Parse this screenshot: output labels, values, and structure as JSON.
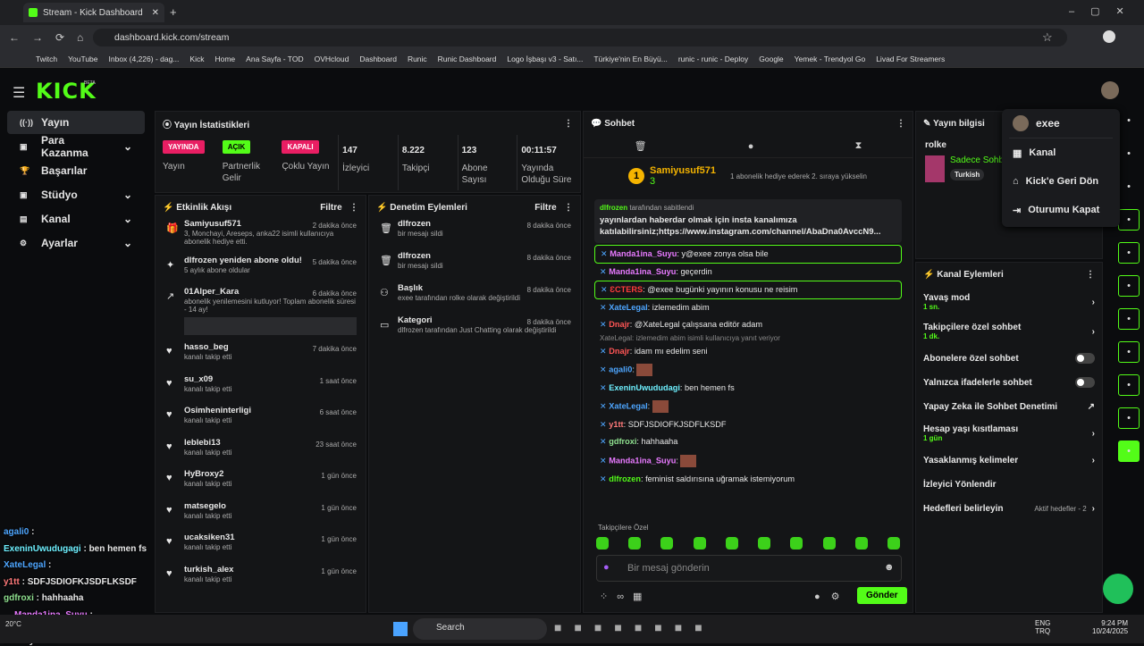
{
  "browser": {
    "tab_title": "Stream - Kick Dashboard",
    "url": "dashboard.kick.com/stream",
    "bookmarks": [
      "Twitch",
      "YouTube",
      "Inbox (4,226) - dag...",
      "Kick",
      "Home",
      "Ana Sayfa - TOD",
      "OVHcloud",
      "Dashboard",
      "Runic",
      "Runic Dashboard",
      "Logo İşbaşı v3 - Satı...",
      "Türkiye'nin En Büyü...",
      "runic - runic - Deploy",
      "Google",
      "Yemek - Trendyol Go",
      "Livad For Streamers"
    ]
  },
  "logo": "KICK",
  "logo_beta": "BETA",
  "sidebar": {
    "items": [
      {
        "label": "Yayın",
        "icon": "radio-icon"
      },
      {
        "label": "Para Kazanma",
        "icon": "wallet-icon"
      },
      {
        "label": "Başarılar",
        "icon": "trophy-icon"
      },
      {
        "label": "Stüdyo",
        "icon": "studio-icon"
      },
      {
        "label": "Kanal",
        "icon": "channel-icon"
      },
      {
        "label": "Ayarlar",
        "icon": "gear-icon"
      }
    ]
  },
  "stats": {
    "title": "Yayın İstatistikleri",
    "items": [
      {
        "badge": "YAYINDA",
        "label": "Yayın",
        "badge_color": "#e91e63"
      },
      {
        "badge": "AÇIK",
        "label": "Partnerlik Gelir",
        "badge_color": "#53fc18"
      },
      {
        "badge": "KAPALI",
        "label": "Çoklu Yayın",
        "badge_color": "#e91e63"
      },
      {
        "value": "147",
        "label": "İzleyici"
      },
      {
        "value": "8.222",
        "label": "Takipçi"
      },
      {
        "value": "123",
        "label": "Abone Sayısı"
      },
      {
        "value": "00:11:57",
        "label": "Yayında Olduğu Süre"
      }
    ]
  },
  "activity": {
    "title": "Etkinlik Akışı",
    "filter": "Filtre",
    "events": [
      {
        "name": "Samiyusuf571",
        "time": "2 dakika önce",
        "sub": "3, Monchayi, Areseps, anka22 isimli kullanıcıya abonelik hediye etti."
      },
      {
        "name": "dlfrozen yeniden abone oldu!",
        "time": "5 dakika önce",
        "sub": "5 aylık abone oldular"
      },
      {
        "name": "01Alper_Kara",
        "time": "6 dakika önce",
        "sub": "abonelik yenilemesini kutluyor! Toplam abonelik süresi - 14 ay!"
      },
      {
        "name": "hasso_beg",
        "time": "7 dakika önce",
        "sub": "kanalı takip etti"
      },
      {
        "name": "su_x09",
        "time": "1 saat önce",
        "sub": "kanalı takip etti"
      },
      {
        "name": "Osimheninterligi",
        "time": "6 saat önce",
        "sub": "kanalı takip etti"
      },
      {
        "name": "leblebi13",
        "time": "23 saat önce",
        "sub": "kanalı takip etti"
      },
      {
        "name": "HyBroxy2",
        "time": "1 gün önce",
        "sub": "kanalı takip etti"
      },
      {
        "name": "matsegelo",
        "time": "1 gün önce",
        "sub": "kanalı takip etti"
      },
      {
        "name": "ucaksiken31",
        "time": "1 gün önce",
        "sub": "kanalı takip etti"
      },
      {
        "name": "turkish_alex",
        "time": "1 gün önce",
        "sub": "kanalı takip etti"
      }
    ]
  },
  "moderation": {
    "title": "Denetim Eylemleri",
    "filter": "Filtre",
    "items": [
      {
        "name": "dlfrozen",
        "time": "8 dakika önce",
        "sub": "bir mesajı sildi"
      },
      {
        "name": "dlfrozen",
        "time": "8 dakika önce",
        "sub": "bir mesajı sildi"
      },
      {
        "name": "Başlık",
        "time": "8 dakika önce",
        "sub": "exee tarafından rolke olarak değiştirildi"
      },
      {
        "name": "Kategori",
        "time": "8 dakika önce",
        "sub": "dlfrozen tarafından Just Chatting olarak değiştirildi"
      }
    ]
  },
  "chat": {
    "title": "Sohbet",
    "gift_user": "Samiyusuf571",
    "gift_count": "3",
    "gift_text": "1 abonelik hediye ederek 2. sıraya yükselin",
    "pinned_by": "dlfrozen",
    "pinned_suffix": "tarafından sabitlendi",
    "pinned_text": "yayınlardan haberdar olmak için insta kanalımıza katılabilirsiniz;https://www.instagram.com/channel/AbaDna0AvccN9...",
    "messages": [
      {
        "user": "Manda1ina_Suyu",
        "text": "y@exee zonya olsa bile",
        "color": "#e87aff",
        "hl": true
      },
      {
        "user": "Manda1ina_Suyu",
        "text": "geçerdin",
        "color": "#e87aff"
      },
      {
        "user": "ƐCTERS",
        "text": "@exee bugünki yayının konusu ne reisim",
        "color": "#ff3b3b",
        "hl": true
      },
      {
        "user": "XateLegal",
        "text": "izlemedim abim",
        "color": "#4ea6ff"
      },
      {
        "user": "Dnajr",
        "text": "@XateLegal çalışsana editör adam",
        "color": "#ff5555"
      },
      {
        "user": "",
        "text": "XateLegal: izlemedim abim isimli kullanıcıya yanıt veriyor",
        "color": "#888",
        "reply": true
      },
      {
        "user": "Dnajr",
        "text": "idam mı edelim seni",
        "color": "#ff5555"
      },
      {
        "user": "agali0",
        "text": "",
        "color": "#4ea6ff"
      },
      {
        "user": "ExeninUwududagi",
        "text": "ben hemen fs",
        "color": "#6ef0ff"
      },
      {
        "user": "XateLegal",
        "text": "",
        "color": "#4ea6ff"
      },
      {
        "user": "y1tt",
        "text": "SDFJSDIOFKJSDFLKSDF",
        "color": "#ff7a7a"
      },
      {
        "user": "gdfroxi",
        "text": "hahhaaha",
        "color": "#8fe08f"
      },
      {
        "user": "Manda1ina_Suyu",
        "text": "",
        "color": "#e87aff"
      },
      {
        "user": "dlfrozen",
        "text": "feminist saldırısına uğramak istemiyorum",
        "color": "#53fc18"
      }
    ],
    "followers_only": "Takipçilere Özel",
    "placeholder": "Bir mesaj gönderin",
    "send": "Gönder"
  },
  "stream_info": {
    "title": "Yayın bilgisi",
    "stream_title": "rolke",
    "category": "Sadece Sohbet",
    "tag": "Turkish"
  },
  "channel_actions": {
    "title": "Kanal Eylemleri",
    "items": [
      {
        "label": "Yavaş mod",
        "sub": "1 sn.",
        "ctrl": "arrow"
      },
      {
        "label": "Takipçilere özel sohbet",
        "sub": "1 dk.",
        "ctrl": "arrow"
      },
      {
        "label": "Abonelere özel sohbet",
        "sub": "",
        "ctrl": "toggle"
      },
      {
        "label": "Yalnızca ifadelerle sohbet",
        "sub": "",
        "ctrl": "toggle"
      },
      {
        "label": "Yapay Zeka ile Sohbet Denetimi",
        "sub": "",
        "ctrl": "ext"
      },
      {
        "label": "Hesap yaşı kısıtlaması",
        "sub": "1 gün",
        "ctrl": "arrow"
      },
      {
        "label": "Yasaklanmış kelimeler",
        "sub": "",
        "ctrl": "arrow"
      },
      {
        "label": "İzleyici Yönlendir",
        "sub": "",
        "ctrl": ""
      },
      {
        "label": "Hedefleri belirleyin",
        "sub": "",
        "ctrl": "arrow",
        "extra": "Aktif hedefler - 2"
      }
    ]
  },
  "user_menu": {
    "username": "exee",
    "items": [
      "Kanal",
      "Kick'e Geri Dön",
      "Oturumu Kapat"
    ]
  },
  "overlay": [
    {
      "user": "agali0",
      "text": "",
      "color": "#4ea6ff"
    },
    {
      "user": "ExeninUwudugagi",
      "text": "ben hemen fs",
      "color": "#6ef0ff"
    },
    {
      "user": "XateLegal",
      "text": "",
      "color": "#4ea6ff"
    },
    {
      "user": "y1tt",
      "text": "SDFJSDIOFKJSDFLKSDF",
      "color": "#ff7a7a"
    },
    {
      "user": "gdfroxi",
      "text": "hahhaaha",
      "color": "#8fe08f"
    },
    {
      "user": "Manda1ina_Suyu",
      "text": "",
      "color": "#e87aff"
    },
    {
      "user": "dlfrozen",
      "text": "feminist saldırısına uğramak istemiyorum",
      "color": "#53fc18"
    }
  ],
  "taskbar": {
    "search": "Search",
    "temp": "20°C",
    "lang": "ENG",
    "lang2": "TRQ",
    "time": "9:24 PM",
    "date": "10/24/2025"
  }
}
